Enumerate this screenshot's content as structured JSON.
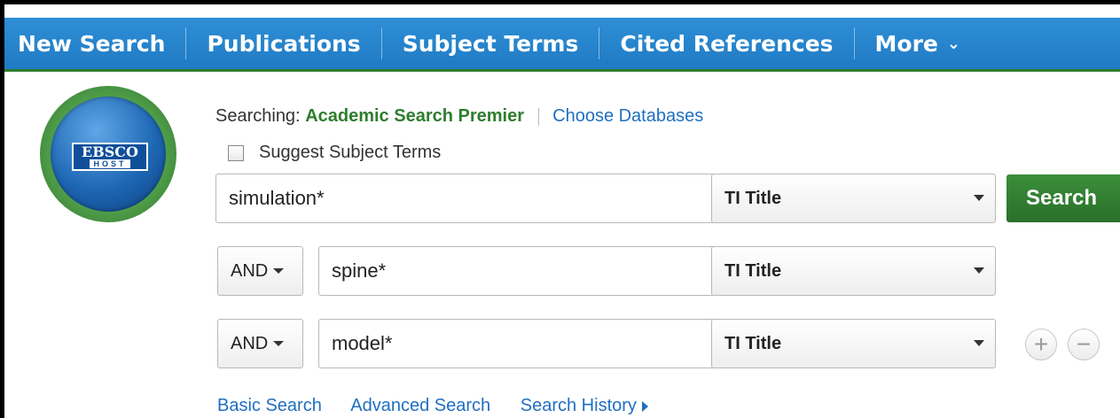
{
  "nav": {
    "items": [
      "New Search",
      "Publications",
      "Subject Terms",
      "Cited References",
      "More"
    ]
  },
  "logo": {
    "line1": "EBSCO",
    "line2": "HOST"
  },
  "searching": {
    "label": "Searching:",
    "database": "Academic Search Premier",
    "choose_link": "Choose Databases"
  },
  "suggest": {
    "label": "Suggest Subject Terms",
    "checked": false
  },
  "rows": [
    {
      "bool": "",
      "term": "simulation*",
      "field": "TI Title"
    },
    {
      "bool": "AND",
      "term": "spine*",
      "field": "TI Title"
    },
    {
      "bool": "AND",
      "term": "model*",
      "field": "TI Title"
    }
  ],
  "search_button": "Search",
  "row_controls": {
    "add": "+",
    "remove": "−"
  },
  "bottom_links": {
    "basic": "Basic Search",
    "advanced": "Advanced Search",
    "history": "Search History"
  },
  "colors": {
    "nav_blue": "#2585cf",
    "brand_green": "#2e7d2e",
    "link_blue": "#1f6fc1"
  }
}
